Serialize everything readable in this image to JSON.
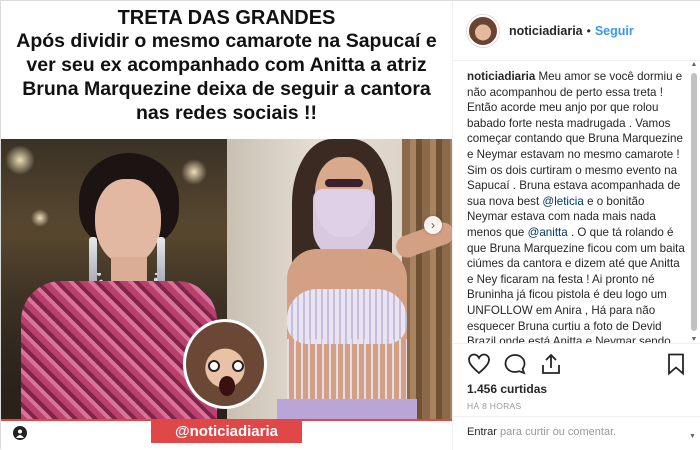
{
  "post_image": {
    "headline_title": "TRETA DAS GRANDES",
    "headline_body": "Após dividir o mesmo camarote na Sapucaí e ver seu ex acompanhado com Anitta a atriz Bruna Marquezine deixa de seguir a cantora nas redes sociais !!",
    "handle_banner": "@noticiadiaria",
    "next_arrow": "›"
  },
  "sidebar": {
    "username": "noticiadiaria",
    "follow_label": "Seguir",
    "caption_user": "noticiadiaria",
    "caption_1": " Meu amor se você dormiu e não acompanhou de perto essa treta ! Então acorde meu anjo por que rolou babado forte nesta madrugada . Vamos começar contando que Bruna Marquezine e Neymar estavam no mesmo camarote ! Sim os dois curtiram o mesmo evento na Sapucaí . Bruna estava acompanhada de sua nova best ",
    "mention_1": "@leticia",
    "caption_2": " e o bonitão Neymar estava com nada mais nada menos que ",
    "mention_2": "@anitta",
    "caption_3": " . O que tá rolando é que Bruna Marquezine ficou com um baita ciúmes da cantora e dizem até que Anitta e Ney ficaram na festa ! Ai pronto né Bruninha já ficou pistola é deu logo um UNFOLLOW em Anira , Há para não esquecer Bruna curtiu a foto de Devid Brazil onde está Anitta e Neymar sendo que ela nem segue David mais KKK . Passou horas e",
    "likes": "1.456 curtidas",
    "time": "HÁ 8 HORAS",
    "comment_login": "Entrar",
    "comment_placeholder": " para curtir ou comentar."
  },
  "icons": [
    "heart-icon",
    "comment-icon",
    "share-icon",
    "bookmark-icon",
    "user-tag-icon",
    "chevron-right-icon"
  ]
}
